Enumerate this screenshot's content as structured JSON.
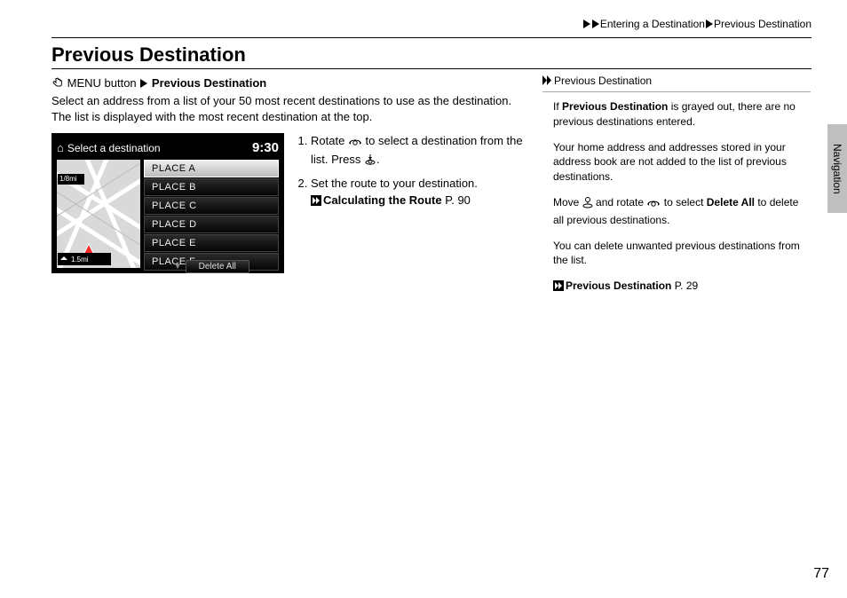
{
  "breadcrumb": {
    "a": "Entering a Destination",
    "b": "Previous Destination"
  },
  "title": "Previous Destination",
  "menu": {
    "button": "MENU button",
    "target": "Previous Destination"
  },
  "desc": "Select an address from a list of your 50 most recent destinations to use as the destination. The list is displayed with the most recent destination at the top.",
  "screenshot": {
    "header": "Select a destination",
    "clock": "9:30",
    "scale_top": "1/8mi",
    "scale_bottom": "1.5mi",
    "items": [
      "PLACE A",
      "PLACE B",
      "PLACE C",
      "PLACE D",
      "PLACE E",
      "PLACE F"
    ],
    "delete": "Delete All"
  },
  "steps": {
    "s1a": "Rotate ",
    "s1b": " to select a destination from the list. Press ",
    "s1c": ".",
    "s2": "Set the route to your destination.",
    "ref1": "Calculating the Route",
    "ref1p": " P. 90"
  },
  "right": {
    "title": "Previous Destination",
    "p1a": "If ",
    "p1b": "Previous Destination",
    "p1c": " is grayed out, there are no previous destinations entered.",
    "p2": "Your home address and addresses stored in your address book are not added to the list of previous destinations.",
    "p3a": "Move ",
    "p3b": " and rotate ",
    "p3c": " to select ",
    "p3d": "Delete All",
    "p3e": " to delete all previous destinations.",
    "p4": "You can delete unwanted previous destinations from the list.",
    "ref2": "Previous Destination",
    "ref2p": " P. 29"
  },
  "sidetab": "Navigation",
  "page": "77"
}
